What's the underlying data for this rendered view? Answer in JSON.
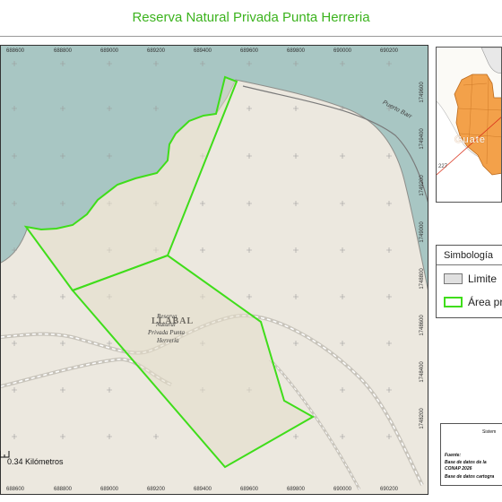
{
  "title": "Reserva Natural Privada Punta Herreria",
  "map": {
    "x_ticks": [
      "688600",
      "688800",
      "689000",
      "689200",
      "689400",
      "689600",
      "689800",
      "690000",
      "690200"
    ],
    "y_ticks": [
      "1749600",
      "1749400",
      "1749200",
      "1749000",
      "1748800",
      "1748600",
      "1748400",
      "1748200"
    ],
    "road_label": "Puerto Barr",
    "place_label": "LLABAL",
    "reserve_label_lines": [
      "Reserva",
      "Natural",
      "Privada Punta",
      "Herreria"
    ]
  },
  "locator": {
    "label": "Guate",
    "road_number": "227"
  },
  "legend": {
    "title": "Simbología",
    "items": [
      {
        "label": "Limite",
        "fill": "#e0e0e0",
        "stroke": "#777777"
      },
      {
        "label": "Área pr",
        "fill": "#ffffff",
        "stroke": "#3fdd1a"
      }
    ]
  },
  "source": {
    "system": "Sistem",
    "heading": "Fuente:",
    "lines": [
      "Base de datos de la",
      "CONAP 2026",
      "Base de datos cartogra"
    ]
  },
  "scale": {
    "label": "0.34 Kilómetros"
  },
  "colors": {
    "title": "#3cb31e",
    "reserve_outline": "#3fdd1a",
    "water": "#a8c6c3",
    "land": "#ede9e0"
  }
}
